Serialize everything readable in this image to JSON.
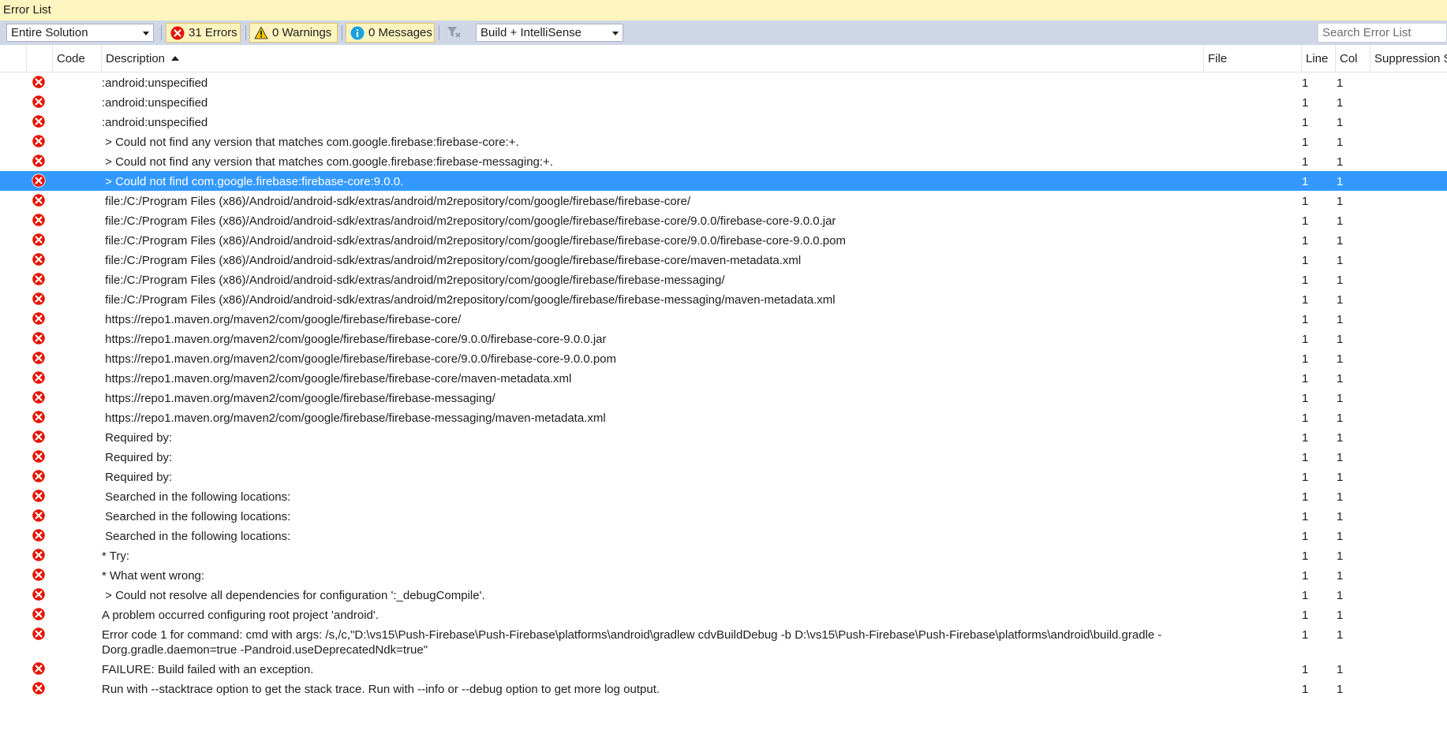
{
  "window": {
    "title": "Error List"
  },
  "toolbar": {
    "scope_value": "Entire Solution",
    "errors_label": "31 Errors",
    "warnings_label": "0 Warnings",
    "messages_label": "0 Messages",
    "source_value": "Build + IntelliSense",
    "search_placeholder": "Search Error List"
  },
  "columns": {
    "code": "Code",
    "description": "Description",
    "file": "File",
    "line": "Line",
    "col": "Col",
    "suppression": "Suppression S"
  },
  "colors": {
    "title_bg": "#fdf4bf",
    "toolbar_bg": "#cfd6e5",
    "error_red": "#e51400",
    "selected_row": "#3399ff"
  },
  "rows": [
    {
      "description": ":android:unspecified",
      "line": "1",
      "col": "1"
    },
    {
      "description": ":android:unspecified",
      "line": "1",
      "col": "1"
    },
    {
      "description": ":android:unspecified",
      "line": "1",
      "col": "1"
    },
    {
      "description": " > Could not find any version that matches com.google.firebase:firebase-core:+.",
      "line": "1",
      "col": "1"
    },
    {
      "description": " > Could not find any version that matches com.google.firebase:firebase-messaging:+.",
      "line": "1",
      "col": "1"
    },
    {
      "description": " > Could not find com.google.firebase:firebase-core:9.0.0.",
      "line": "1",
      "col": "1",
      "selected": true
    },
    {
      "description": " file:/C:/Program Files (x86)/Android/android-sdk/extras/android/m2repository/com/google/firebase/firebase-core/",
      "line": "1",
      "col": "1"
    },
    {
      "description": " file:/C:/Program Files (x86)/Android/android-sdk/extras/android/m2repository/com/google/firebase/firebase-core/9.0.0/firebase-core-9.0.0.jar",
      "line": "1",
      "col": "1"
    },
    {
      "description": " file:/C:/Program Files (x86)/Android/android-sdk/extras/android/m2repository/com/google/firebase/firebase-core/9.0.0/firebase-core-9.0.0.pom",
      "line": "1",
      "col": "1"
    },
    {
      "description": " file:/C:/Program Files (x86)/Android/android-sdk/extras/android/m2repository/com/google/firebase/firebase-core/maven-metadata.xml",
      "line": "1",
      "col": "1"
    },
    {
      "description": " file:/C:/Program Files (x86)/Android/android-sdk/extras/android/m2repository/com/google/firebase/firebase-messaging/",
      "line": "1",
      "col": "1"
    },
    {
      "description": " file:/C:/Program Files (x86)/Android/android-sdk/extras/android/m2repository/com/google/firebase/firebase-messaging/maven-metadata.xml",
      "line": "1",
      "col": "1"
    },
    {
      "description": " https://repo1.maven.org/maven2/com/google/firebase/firebase-core/",
      "line": "1",
      "col": "1"
    },
    {
      "description": " https://repo1.maven.org/maven2/com/google/firebase/firebase-core/9.0.0/firebase-core-9.0.0.jar",
      "line": "1",
      "col": "1"
    },
    {
      "description": " https://repo1.maven.org/maven2/com/google/firebase/firebase-core/9.0.0/firebase-core-9.0.0.pom",
      "line": "1",
      "col": "1"
    },
    {
      "description": " https://repo1.maven.org/maven2/com/google/firebase/firebase-core/maven-metadata.xml",
      "line": "1",
      "col": "1"
    },
    {
      "description": " https://repo1.maven.org/maven2/com/google/firebase/firebase-messaging/",
      "line": "1",
      "col": "1"
    },
    {
      "description": " https://repo1.maven.org/maven2/com/google/firebase/firebase-messaging/maven-metadata.xml",
      "line": "1",
      "col": "1"
    },
    {
      "description": " Required by:",
      "line": "1",
      "col": "1"
    },
    {
      "description": " Required by:",
      "line": "1",
      "col": "1"
    },
    {
      "description": " Required by:",
      "line": "1",
      "col": "1"
    },
    {
      "description": " Searched in the following locations:",
      "line": "1",
      "col": "1"
    },
    {
      "description": " Searched in the following locations:",
      "line": "1",
      "col": "1"
    },
    {
      "description": " Searched in the following locations:",
      "line": "1",
      "col": "1"
    },
    {
      "description": "* Try:",
      "line": "1",
      "col": "1"
    },
    {
      "description": "* What went wrong:",
      "line": "1",
      "col": "1"
    },
    {
      "description": " > Could not resolve all dependencies for configuration ':_debugCompile'.",
      "line": "1",
      "col": "1"
    },
    {
      "description": "A problem occurred configuring root project 'android'.",
      "line": "1",
      "col": "1"
    },
    {
      "description": "Error code 1 for command: cmd with args: /s,/c,\"D:\\vs15\\Push-Firebase\\Push-Firebase\\platforms\\android\\gradlew cdvBuildDebug -b D:\\vs15\\Push-Firebase\\Push-Firebase\\platforms\\android\\build.gradle -Dorg.gradle.daemon=true -Pandroid.useDeprecatedNdk=true\"",
      "line": "1",
      "col": "1",
      "tall": true
    },
    {
      "description": "FAILURE: Build failed with an exception.",
      "line": "1",
      "col": "1"
    },
    {
      "description": "Run with --stacktrace option to get the stack trace. Run with --info or --debug option to get more log output.",
      "line": "1",
      "col": "1"
    }
  ]
}
